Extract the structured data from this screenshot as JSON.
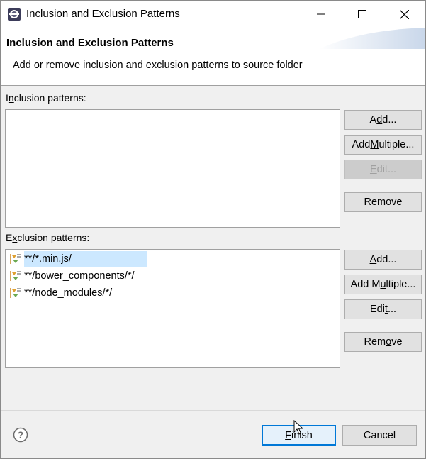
{
  "window": {
    "title": "Inclusion and Exclusion Patterns",
    "controls": [
      "minimize",
      "maximize",
      "close"
    ]
  },
  "banner": {
    "title": "Inclusion and Exclusion Patterns",
    "message": "Add or remove inclusion and exclusion patterns to source folder"
  },
  "inclusion": {
    "label_pre": "I",
    "label_mn": "n",
    "label_post": "clusion patterns:",
    "items": [],
    "buttons": {
      "add": {
        "pre": "A",
        "mn": "d",
        "post": "d..."
      },
      "add_multiple": {
        "pre": "Add ",
        "mn": "M",
        "post": "ultiple..."
      },
      "edit": {
        "pre": "",
        "mn": "E",
        "post": "dit...",
        "enabled": false
      },
      "remove": {
        "pre": "",
        "mn": "R",
        "post": "emove"
      }
    }
  },
  "exclusion": {
    "label_pre": "E",
    "label_mn": "x",
    "label_post": "clusion patterns:",
    "items": [
      "**/*.min.js/",
      "**/bower_components/*/",
      "**/node_modules/*/"
    ],
    "selected_index": 0,
    "buttons": {
      "add": {
        "pre": "",
        "mn": "A",
        "post": "dd..."
      },
      "add_multiple": {
        "pre": "Add M",
        "mn": "u",
        "post": "ltiple..."
      },
      "edit": {
        "pre": "Edi",
        "mn": "t",
        "post": "...",
        "enabled": true
      },
      "remove": {
        "pre": "Rem",
        "mn": "o",
        "post": "ve"
      }
    }
  },
  "footer": {
    "help_icon": "help-icon",
    "finish": {
      "pre": "",
      "mn": "F",
      "post": "inish"
    },
    "cancel": "Cancel"
  },
  "colors": {
    "selection": "#cce8ff",
    "default_button_border": "#0078d7",
    "dialog_bg": "#f0f0f0"
  }
}
